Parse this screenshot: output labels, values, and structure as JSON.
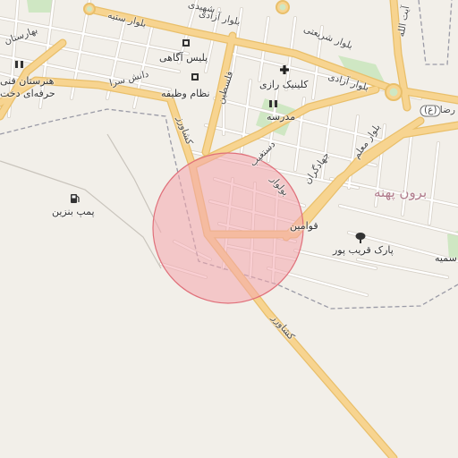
{
  "map": {
    "colors": {
      "background": "#f2efe9",
      "road_major": "#f7d490",
      "road_major_casing": "#e9bf6a",
      "road_minor": "#ffffff",
      "road_minor_casing": "#d7d1c8",
      "park": "#cfe7c3",
      "boundary": "#9a9aa6",
      "highlight_fill": "#f4a6ad",
      "highlight_stroke": "#e0707a"
    },
    "highlight": {
      "shape": "circle",
      "opacity": 0.55
    },
    "labels": {
      "boulevard_azadi_1": "بلوار آزادی",
      "boulevard_azadi_2": "بلوار آزادی",
      "boulevard_sarbaz": "بلوار ستبه",
      "boulevard_shahidi": "بلوار شریعتی",
      "police_agahi": "پلیس آگاهی",
      "nezam_vazife": "نظام وظیفه",
      "palestine": "فلسطین",
      "clinic_razi": "کلینیک رازی",
      "madrese": "مدرسه",
      "ayatollah": "آیت الله",
      "reza_road": "رضا (ع)",
      "honarestan_1": "هنرستان فنی",
      "honarestan_2": "حرفه‌ای دخت",
      "baharestan": "بهارستان",
      "daneshsara": "دانش سرا",
      "bolvar_moalem": "بلوار معلم",
      "jahadgaran": "جهادگران",
      "dastgheib": "دستغیب",
      "boulevard_short": "بولوار",
      "keshavarz_1": "کشاورز",
      "keshavarz_2": "کشاورز",
      "pump": "پمپ بنزین",
      "qavamin": "قوامین",
      "park_gharib": "پارک قریب پور",
      "district": "برون پهنه",
      "smie": "سمیه",
      "shahidi": "شهیدی"
    },
    "icons": {
      "police": "police-icon",
      "nezam": "police-icon",
      "clinic": "clinic-cross-icon",
      "school": "school-icon",
      "school2": "school-icon",
      "fuel": "fuel-pump-icon",
      "park": "tree-icon"
    }
  }
}
